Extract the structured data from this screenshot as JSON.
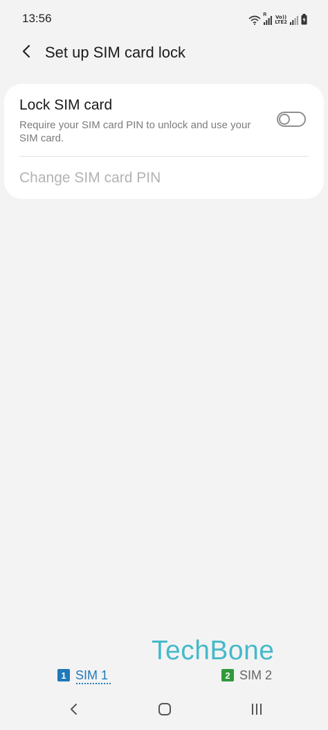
{
  "status_bar": {
    "time": "13:56",
    "volte_top": "Vo))",
    "volte_bottom": "LTE2",
    "roaming_mark": "R",
    "icons": [
      "wifi-icon",
      "signal-icon",
      "volte-lte2-icon",
      "signal-icon",
      "battery-charging-icon"
    ]
  },
  "header": {
    "title": "Set up SIM card lock",
    "back_icon": "back-arrow-icon"
  },
  "settings": {
    "lock_sim": {
      "title": "Lock SIM card",
      "description": "Require your SIM card PIN to unlock and use your SIM card.",
      "toggle_state": "off"
    },
    "change_pin": {
      "label": "Change SIM card PIN",
      "enabled": false
    }
  },
  "watermark": "TechBone",
  "sim_tabs": [
    {
      "badge": "1",
      "label": "SIM 1",
      "selected": true,
      "color": "#1f79b8"
    },
    {
      "badge": "2",
      "label": "SIM 2",
      "selected": false,
      "color": "#2e9a3c"
    }
  ],
  "nav_bar": {
    "icons": [
      "nav-back-icon",
      "nav-home-icon",
      "nav-recents-icon"
    ]
  },
  "colors": {
    "background": "#f3f3f3",
    "card": "#ffffff",
    "sim1_accent": "#1f79b8",
    "sim2_accent": "#2e9a3c",
    "watermark": "#45b9c9"
  }
}
